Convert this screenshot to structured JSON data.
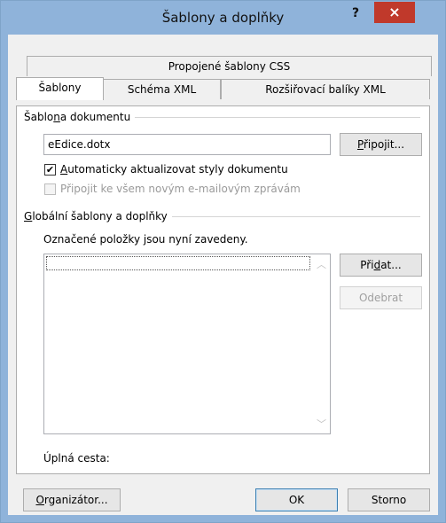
{
  "window": {
    "title": "Šablony a doplňky",
    "help": "?",
    "close": "×"
  },
  "tabs": {
    "row1": [
      {
        "label": "Propojené šablony CSS"
      }
    ],
    "row2": [
      {
        "label": "Šablony"
      },
      {
        "label": "Schéma XML"
      },
      {
        "label": "Rozšiřovací balíky XML"
      }
    ]
  },
  "document_template": {
    "group_label_pre": "Šablo",
    "group_label_ul": "n",
    "group_label_post": "a dokumentu",
    "value": "eEdice.dotx",
    "attach_pre": "",
    "attach_ul": "P",
    "attach_post": "řipojit...",
    "auto_update_ul": "A",
    "auto_update_post": "utomaticky aktualizovat styly dokumentu",
    "auto_update_checked": true,
    "attach_all_label": "Připojit ke všem novým e-mailovým zprávám"
  },
  "global": {
    "group_label_ul": "G",
    "group_label_post": "lobální šablony a doplňky",
    "info": "Označené položky jsou nyní zavedeny.",
    "add_pre": "Při",
    "add_ul": "d",
    "add_post": "at...",
    "remove_label": "Odebrat",
    "full_path_label": "Úplná cesta:"
  },
  "footer": {
    "organizer_ul": "O",
    "organizer_post": "rganizátor...",
    "ok": "OK",
    "cancel": "Storno"
  }
}
